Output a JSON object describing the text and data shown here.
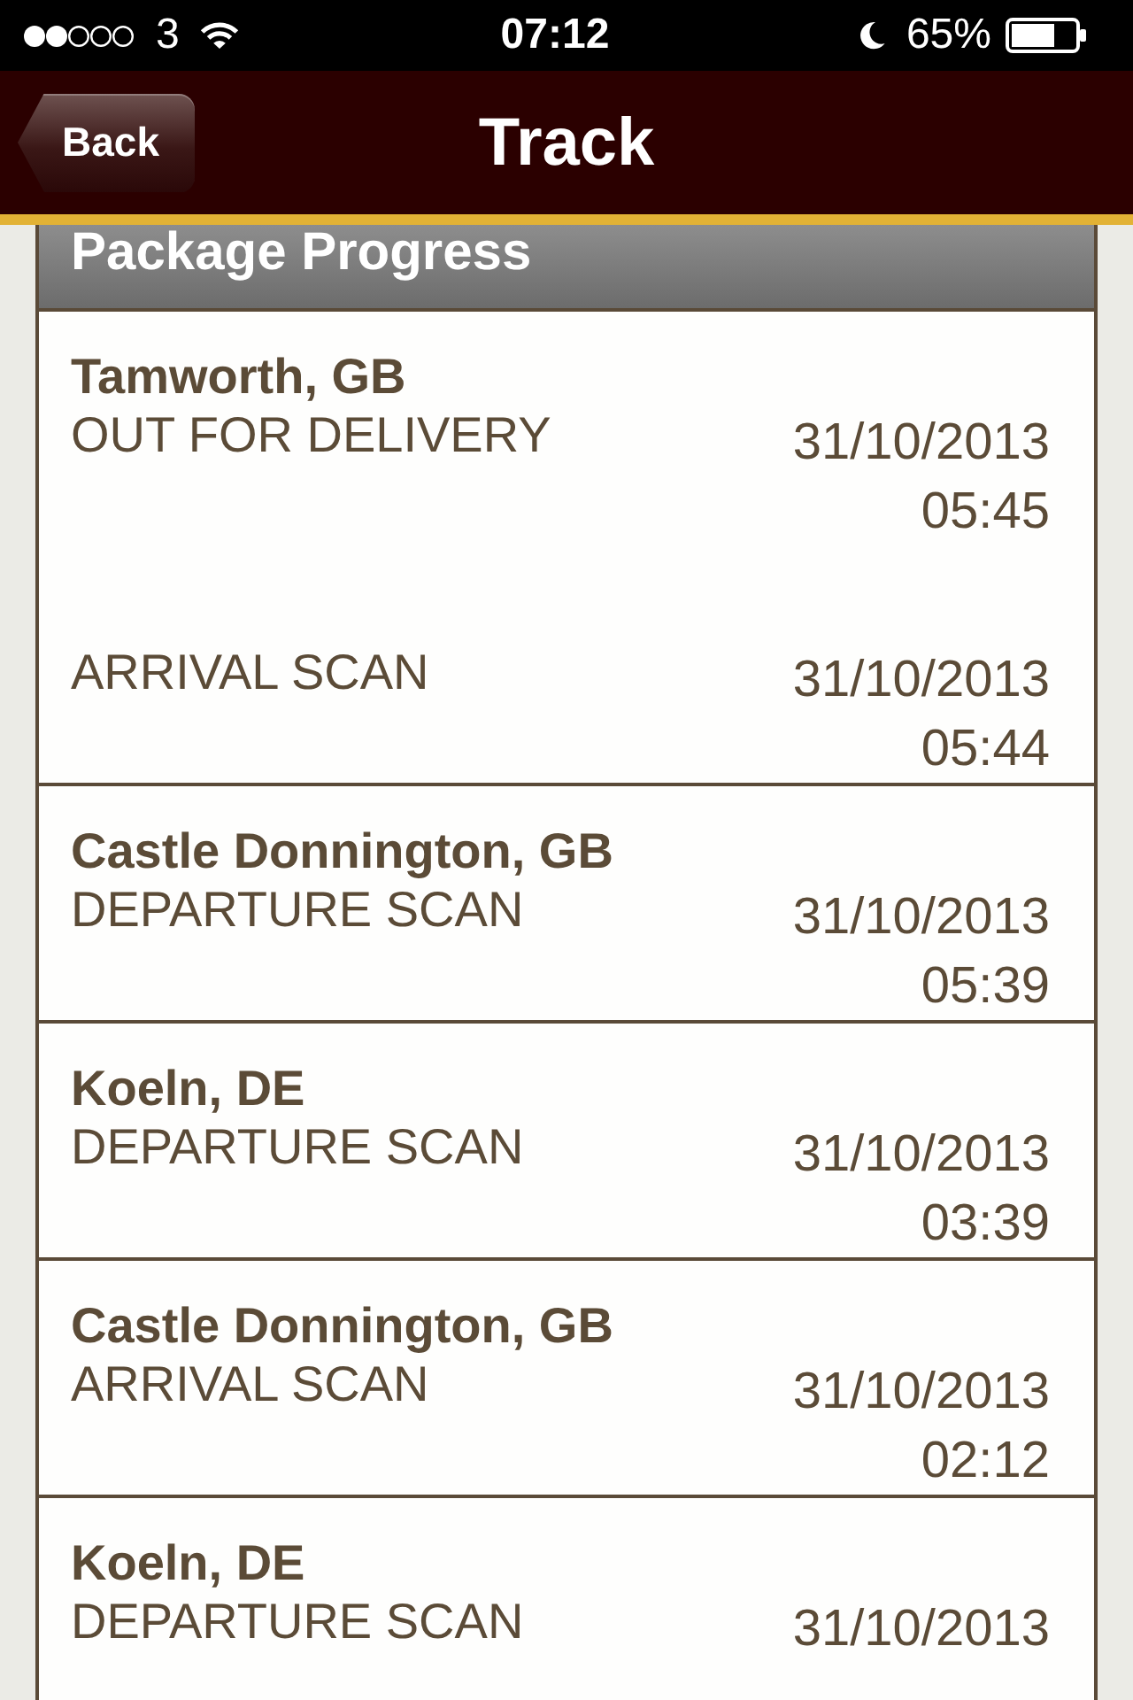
{
  "status_bar": {
    "carrier": "3",
    "time": "07:12",
    "battery": "65%"
  },
  "nav_bar": {
    "back_button": "Back",
    "title": "Track"
  },
  "section_header": "Package Progress",
  "groups": [
    {
      "location": "Tamworth, GB",
      "events": [
        {
          "status": "OUT FOR DELIVERY",
          "date": "31/10/2013",
          "time": "05:45"
        },
        {
          "status": "ARRIVAL SCAN",
          "date": "31/10/2013",
          "time": "05:44"
        }
      ]
    },
    {
      "location": "Castle Donnington, GB",
      "events": [
        {
          "status": "DEPARTURE SCAN",
          "date": "31/10/2013",
          "time": "05:39"
        }
      ]
    },
    {
      "location": "Koeln, DE",
      "events": [
        {
          "status": "DEPARTURE SCAN",
          "date": "31/10/2013",
          "time": "03:39"
        }
      ]
    },
    {
      "location": "Castle Donnington, GB",
      "events": [
        {
          "status": "ARRIVAL SCAN",
          "date": "31/10/2013",
          "time": "02:12"
        }
      ]
    },
    {
      "location": "Koeln, DE",
      "events": [
        {
          "status": "DEPARTURE SCAN",
          "date": "31/10/2013"
        }
      ]
    }
  ]
}
